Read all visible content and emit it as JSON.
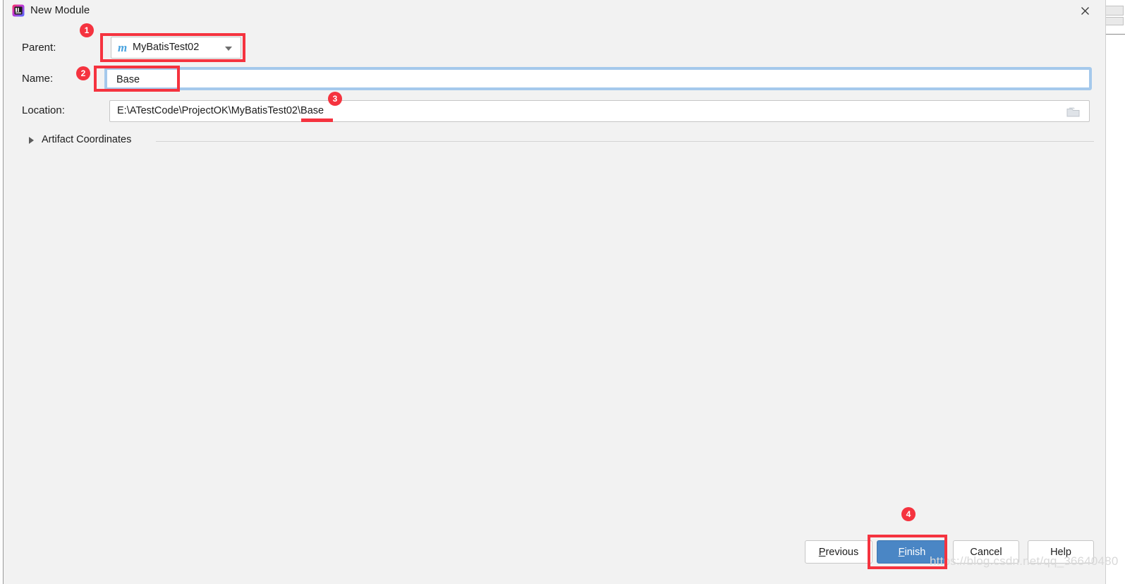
{
  "window": {
    "title": "New Module",
    "app_icon": "intellij-idea-icon",
    "close_label": "✕"
  },
  "form": {
    "parent": {
      "label": "Parent:",
      "value": "MyBatisTest02",
      "icon": "maven-module-icon",
      "icon_glyph": "m",
      "dropdown_icon": "chevron-down-icon"
    },
    "name": {
      "label": "Name:",
      "value": "Base",
      "placeholder": ""
    },
    "location": {
      "label": "Location:",
      "value": "E:\\ATestCode\\ProjectOK\\MyBatisTest02\\Base",
      "placeholder": "",
      "browse_icon": "folder-browse-icon"
    }
  },
  "artifact_coordinates": {
    "label": "Artifact Coordinates",
    "expanded": false,
    "toggle_icon": "triangle-right-icon"
  },
  "buttons": {
    "previous": {
      "label": "Previous",
      "mnemonic": "P"
    },
    "finish": {
      "label": "Finish",
      "mnemonic": "F"
    },
    "cancel": {
      "label": "Cancel",
      "mnemonic": ""
    },
    "help": {
      "label": "Help",
      "mnemonic": ""
    }
  },
  "annotations": {
    "badges": [
      "1",
      "2",
      "3",
      "4"
    ],
    "color": "#F5333F"
  },
  "watermark": {
    "text": "https://blog.csdn.net/qq_36640480"
  },
  "colors": {
    "dialog_background": "#F2F2F2",
    "field_background": "#FFFFFF",
    "focus_ring": "#A5C9EC",
    "primary_button": "#4A86C5",
    "annotation_red": "#F5333F",
    "maven_icon_blue": "#4AA3DF",
    "text": "#1C1C1C"
  }
}
